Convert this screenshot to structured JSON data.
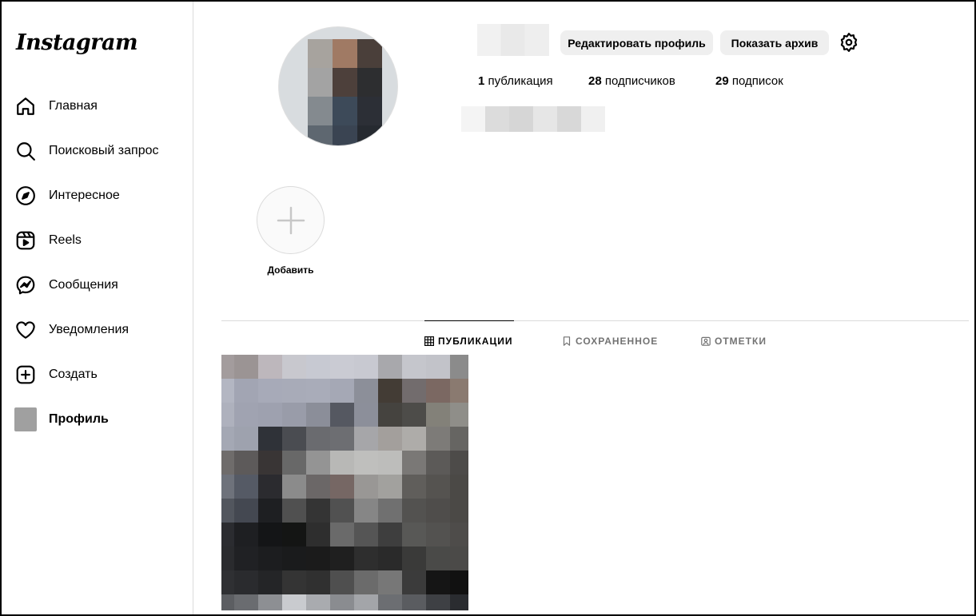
{
  "sidebar": {
    "logo": "Instagram",
    "items": [
      {
        "label": "Главная",
        "icon": "home-icon"
      },
      {
        "label": "Поисковый запрос",
        "icon": "search-icon"
      },
      {
        "label": "Интересное",
        "icon": "compass-icon"
      },
      {
        "label": "Reels",
        "icon": "reels-icon"
      },
      {
        "label": "Сообщения",
        "icon": "messenger-icon"
      },
      {
        "label": "Уведомления",
        "icon": "heart-icon"
      },
      {
        "label": "Создать",
        "icon": "plus-square-icon"
      },
      {
        "label": "Профиль",
        "icon": "avatar",
        "active": true
      }
    ]
  },
  "profile": {
    "edit_button": "Редактировать профиль",
    "archive_button": "Показать архив",
    "stats": {
      "posts_count": "1",
      "posts_label": "публикация",
      "followers_count": "28",
      "followers_label": "подписчиков",
      "following_count": "29",
      "following_label": "подписок"
    }
  },
  "highlights": {
    "new_label": "Добавить"
  },
  "tabs": [
    {
      "label": "ПУБЛИКАЦИИ",
      "icon": "grid-icon",
      "active": true
    },
    {
      "label": "СОХРАНЕННОЕ",
      "icon": "bookmark-icon"
    },
    {
      "label": "ОТМЕТКИ",
      "icon": "tagged-icon"
    }
  ],
  "colors": {
    "button_bg": "#efefef",
    "divider": "#dbdbdb",
    "inactive_tab": "#737373"
  }
}
